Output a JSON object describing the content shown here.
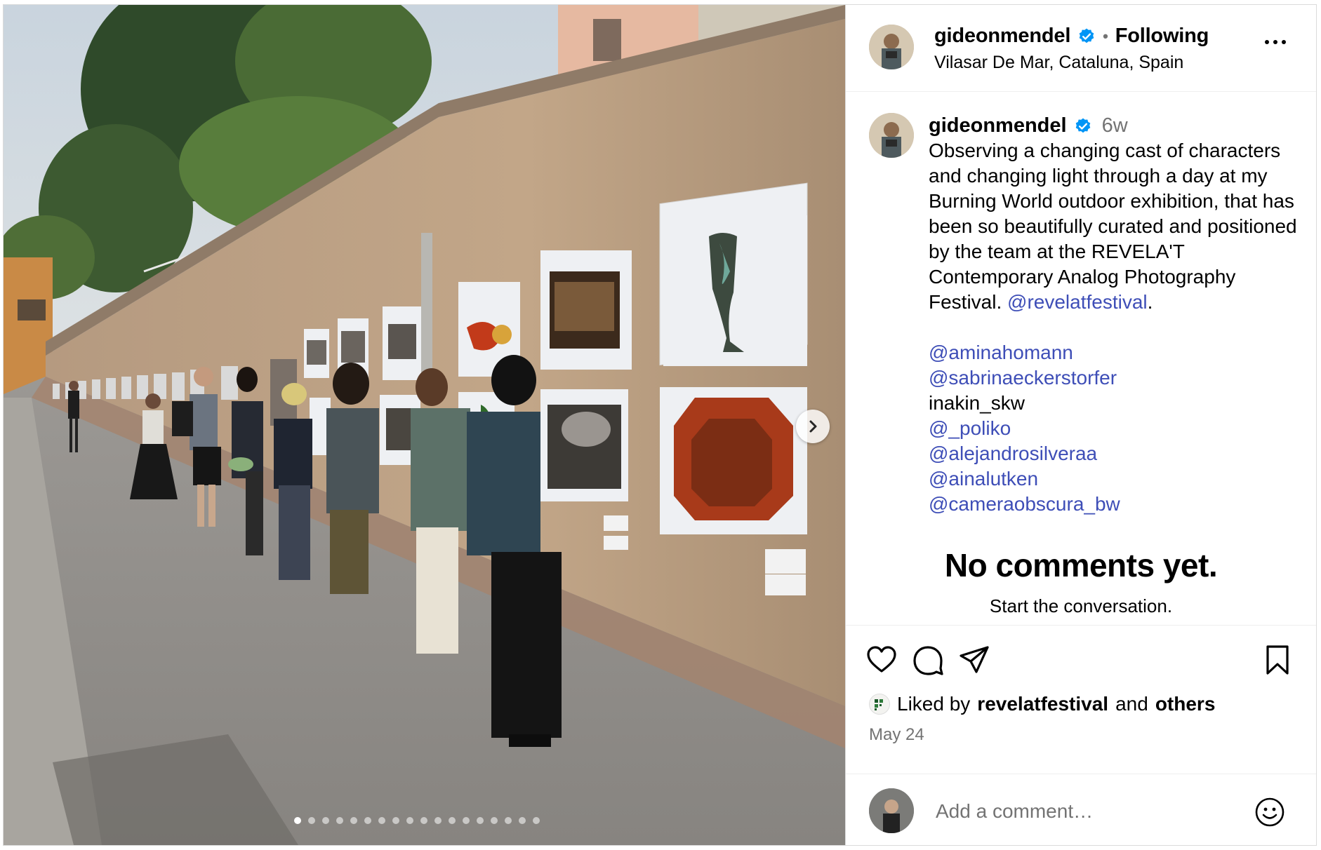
{
  "post": {
    "author": "gideonmendel",
    "follow_status": "Following",
    "separator": "•",
    "location": "Vilasar De Mar, Cataluna, Spain",
    "more_icon": "more-horizontal-icon",
    "verified_icon": "verified-badge-icon"
  },
  "caption": {
    "author": "gideonmendel",
    "time": "6w",
    "text": "Observing a changing cast of characters and changing light through a day at my Burning World outdoor exhibition, that has been so beautifully curated and positioned by the team at the REVELA'T Contemporary Analog Photography Festival.",
    "text_mention": "@revelatfestival",
    "text_end": ".",
    "mentions": [
      "@aminahomann",
      "@sabrinaeckerstorfer",
      "inakin_skw",
      "@_poliko",
      "@alejandrosilveraa",
      "@ainalutken",
      "@cameraobscura_bw"
    ]
  },
  "comments": {
    "empty_title": "No comments yet.",
    "empty_subtitle": "Start the conversation."
  },
  "actions": {
    "like_icon": "heart-icon",
    "comment_icon": "comment-icon",
    "share_icon": "share-icon",
    "save_icon": "bookmark-icon"
  },
  "likes": {
    "prefix": "Liked by",
    "user": "revelatfestival",
    "middle": "and",
    "others": "others"
  },
  "date": "May 24",
  "comment_input": {
    "placeholder": "Add a comment…",
    "emoji_icon": "emoji-icon"
  },
  "carousel": {
    "slide_count": 18,
    "active_index": 0,
    "next_icon": "chevron-right-icon"
  },
  "colors": {
    "mention": "#3e4eb7",
    "verified": "#0095f6",
    "secondary_text": "#737373",
    "border": "#dbdbdb"
  }
}
